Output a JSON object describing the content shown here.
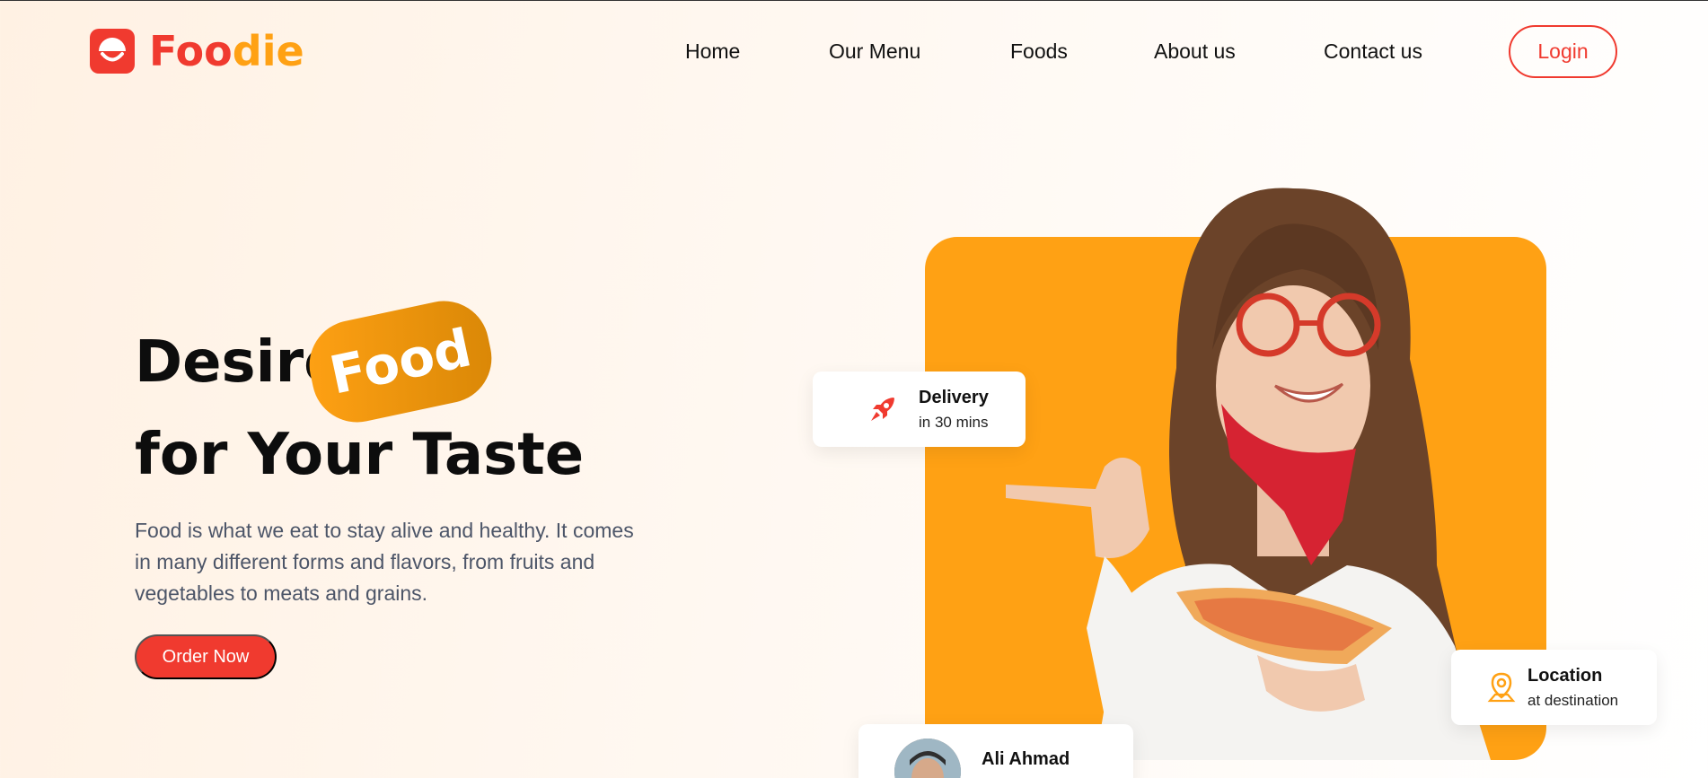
{
  "brand": {
    "part1": "Foo",
    "part2": "die",
    "primary_color": "#f03a2f",
    "accent_color": "#ffa114"
  },
  "nav": {
    "home": "Home",
    "menu": "Our Menu",
    "foods": "Foods",
    "about": "About us",
    "contact": "Contact us"
  },
  "login_label": "Login",
  "hero": {
    "title_word1": "Desire",
    "title_highlight": "Food",
    "title_line2": "for Your Taste",
    "description": "Food is what we eat to stay alive and healthy. It comes in many different forms and flavors, from fruits and vegetables to meats and grains.",
    "cta_label": "Order Now"
  },
  "cards": {
    "delivery": {
      "title": "Delivery",
      "subtitle": "in 30 mins",
      "icon": "rocket-icon"
    },
    "location": {
      "title": "Location",
      "subtitle": "at destination",
      "icon": "location-pin-icon"
    },
    "review": {
      "name": "Ali Ahmad"
    }
  }
}
